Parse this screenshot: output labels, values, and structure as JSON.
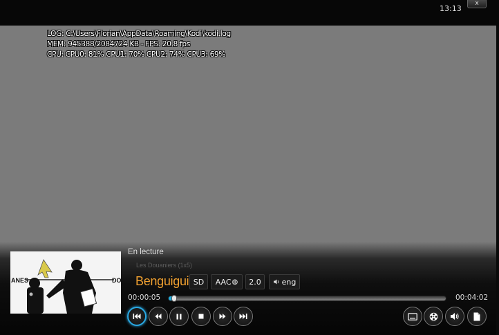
{
  "status_bar": {
    "clock": "13:13",
    "close_label": "x"
  },
  "debug_overlay": {
    "log_line": "LOG: C:\\Users\\Florian\\AppData\\Roaming\\Kodi\\kodi.log",
    "mem_line": "MEM: 945388/2084724 KB - FPS: 20.8 fps",
    "cpu_line": "CPU: CPU0:  81% CPU1:  70% CPU2:  74% CPU3:  69%"
  },
  "now_playing": {
    "label": "En lecture",
    "show": "Les Douaniers (1x5)",
    "title": "Benguigui",
    "thumbnail_text_left": "ANES",
    "thumbnail_text_right": "DO"
  },
  "media_flags": {
    "video_resolution": "SD",
    "audio_codec": "AAC",
    "audio_channels": "2.0",
    "audio_language": "eng"
  },
  "playback": {
    "elapsed": "00:00:05",
    "total": "00:04:02",
    "progress_fraction": 0.02,
    "seek_color": "#1faee0"
  },
  "transport_controls": [
    {
      "name": "previous-button",
      "icon": "skip-previous-icon"
    },
    {
      "name": "rewind-button",
      "icon": "rewind-icon"
    },
    {
      "name": "pause-button",
      "icon": "pause-icon"
    },
    {
      "name": "stop-button",
      "icon": "stop-icon"
    },
    {
      "name": "fast-forward-button",
      "icon": "fast-forward-icon"
    },
    {
      "name": "next-button",
      "icon": "skip-next-icon"
    }
  ],
  "settings_controls": [
    {
      "name": "subtitles-button",
      "icon": "subtitles-icon"
    },
    {
      "name": "video-settings-button",
      "icon": "film-reel-icon"
    },
    {
      "name": "audio-settings-button",
      "icon": "speaker-icon"
    },
    {
      "name": "info-button",
      "icon": "document-icon"
    }
  ]
}
